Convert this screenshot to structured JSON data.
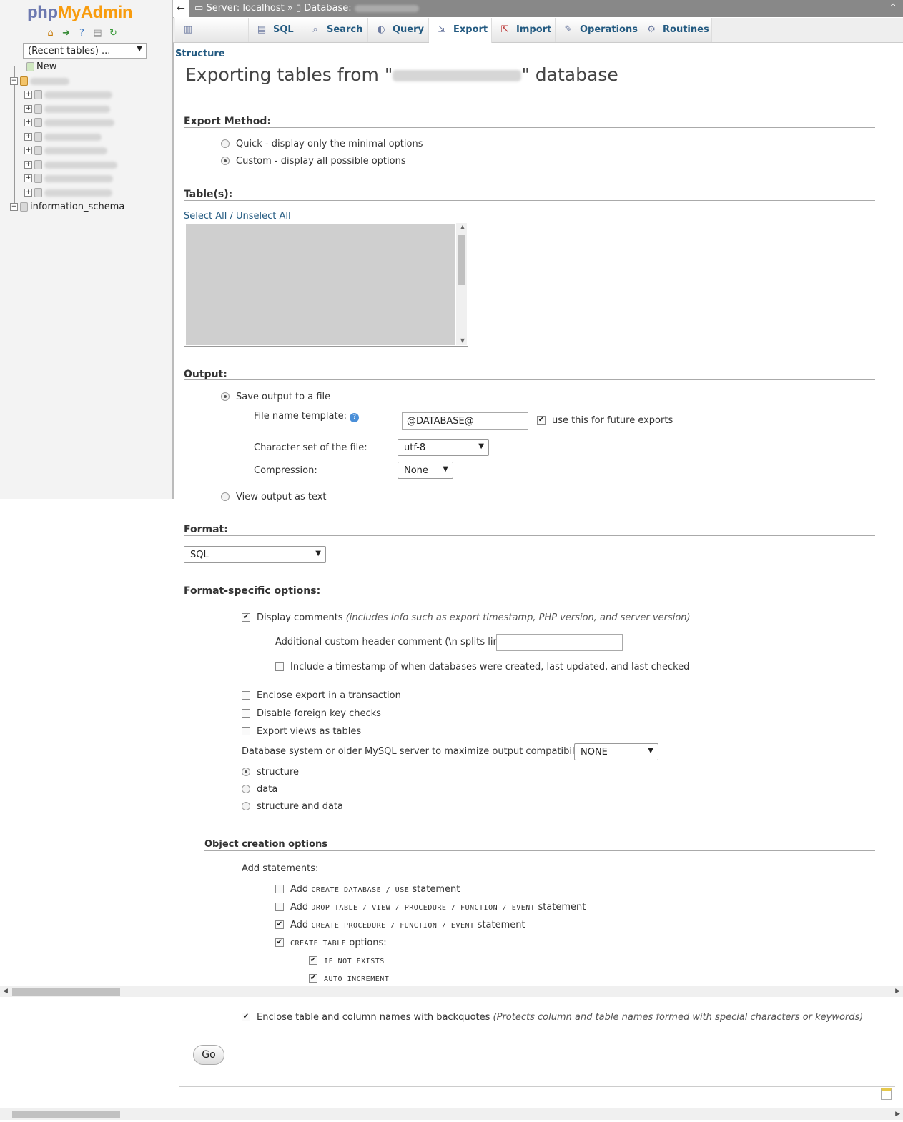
{
  "nav": {
    "logo_part1": "php",
    "logo_part2": "MyAdmin",
    "icons": [
      "home-icon",
      "logout-icon",
      "help-icon",
      "docs-icon",
      "reload-icon"
    ],
    "recent_tables": "(Recent tables) ...",
    "new_label": "New",
    "information_schema": "information_schema"
  },
  "serverbar": {
    "back": "←",
    "server": "Server: localhost",
    "sep": "»",
    "database": "Database:",
    "up": "⌃"
  },
  "tabs": [
    {
      "label": "Structure",
      "icon": "structure-icon"
    },
    {
      "label": "SQL",
      "icon": "sql-icon"
    },
    {
      "label": "Search",
      "icon": "search-icon"
    },
    {
      "label": "Query",
      "icon": "query-icon"
    },
    {
      "label": "Export",
      "icon": "export-icon"
    },
    {
      "label": "Import",
      "icon": "import-icon"
    },
    {
      "label": "Operations",
      "icon": "operations-icon"
    },
    {
      "label": "Routines",
      "icon": "routines-icon"
    }
  ],
  "main": {
    "title_prefix": "Exporting tables from \"",
    "title_suffix": "\" database",
    "export_method": {
      "heading": "Export Method:",
      "quick": "Quick - display only the minimal options",
      "custom": "Custom - display all possible options"
    },
    "tables": {
      "heading": "Table(s):",
      "select_all": "Select All",
      "slash": " / ",
      "unselect_all": "Unselect All"
    },
    "output": {
      "heading": "Output:",
      "save_to_file": "Save output to a file",
      "file_name_template": "File name template:",
      "file_name_value": "@DATABASE@",
      "use_for_future": "use this for future exports",
      "charset_label": "Character set of the file:",
      "charset_value": "utf-8",
      "compression_label": "Compression:",
      "compression_value": "None",
      "view_as_text": "View output as text"
    },
    "format": {
      "heading": "Format:",
      "value": "SQL"
    },
    "format_specific": {
      "heading": "Format-specific options:",
      "display_comments": "Display comments",
      "display_comments_note": "(includes info such as export timestamp, PHP version, and server version)",
      "custom_header": "Additional custom header comment (\\n splits lines):",
      "include_timestamp": "Include a timestamp of when databases were created, last updated, and last checked",
      "enclose_transaction": "Enclose export in a transaction",
      "disable_fk": "Disable foreign key checks",
      "views_as_tables": "Export views as tables",
      "compat_label": "Database system or older MySQL server to maximize output compatibility with:",
      "compat_value": "NONE",
      "structure": "structure",
      "data": "data",
      "structure_and_data": "structure and data"
    },
    "object_creation": {
      "heading": "Object creation options",
      "add_statements": "Add statements:",
      "add": "Add",
      "create_database_use": "CREATE DATABASE / USE",
      "drop_line": "DROP TABLE / VIEW / PROCEDURE / FUNCTION / EVENT",
      "create_proc_line": "CREATE PROCEDURE / FUNCTION / EVENT",
      "statement": "statement",
      "create_table": "CREATE TABLE",
      "options": "options:",
      "if_not_exists": "IF NOT EXISTS",
      "auto_increment": "AUTO_INCREMENT"
    },
    "backquotes": "Enclose table and column names with backquotes",
    "backquotes_note": "(Protects column and table names formed with special characters or keywords)",
    "go": "Go"
  }
}
